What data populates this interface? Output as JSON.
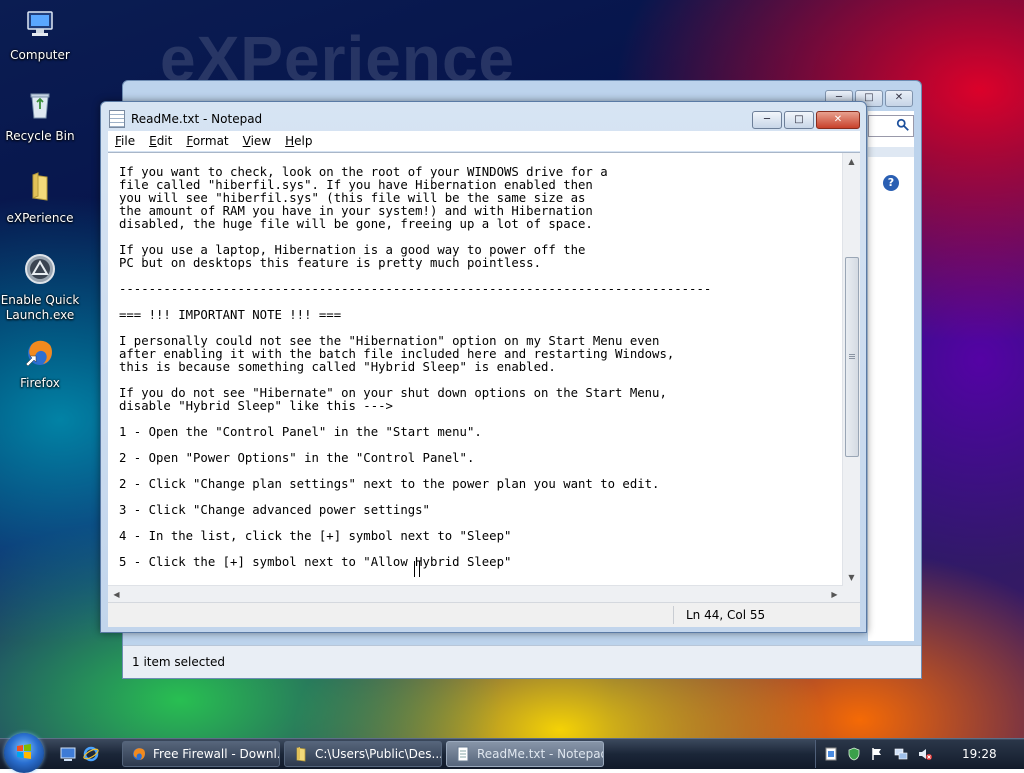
{
  "desktop": {
    "watermark": "eXPerience",
    "icons": [
      {
        "label": "Computer",
        "icon": "computer-icon"
      },
      {
        "label": "Recycle Bin",
        "icon": "recycle-bin-icon"
      },
      {
        "label": "eXPerience",
        "icon": "folder-icon"
      },
      {
        "label": "Enable Quick\nLaunch.exe",
        "icon": "app-icon"
      },
      {
        "label": "Firefox",
        "icon": "firefox-icon"
      }
    ]
  },
  "explorer": {
    "status_text": "1 item selected",
    "help_glyph": "?"
  },
  "notepad": {
    "title": "ReadMe.txt - Notepad",
    "menu": [
      "File",
      "Edit",
      "Format",
      "View",
      "Help"
    ],
    "lines": [
      "If you want to check, look on the root of your WINDOWS drive for a",
      "file called \"hiberfil.sys\". If you have Hibernation enabled then",
      "you will see \"hiberfil.sys\" (this file will be the same size as",
      "the amount of RAM you have in your system!) and with Hibernation",
      "disabled, the huge file will be gone, freeing up a lot of space.",
      "",
      "If you use a laptop, Hibernation is a good way to power off the",
      "PC but on desktops this feature is pretty much pointless.",
      "",
      "--------------------------------------------------------------------------------",
      "",
      "=== !!! IMPORTANT NOTE !!! ===",
      "",
      "I personally could not see the \"Hibernation\" option on my Start Menu even",
      "after enabling it with the batch file included here and restarting Windows,",
      "this is because something called \"Hybrid Sleep\" is enabled.",
      "",
      "If you do not see \"Hibernate\" on your shut down options on the Start Menu,",
      "disable \"Hybrid Sleep\" like this --->",
      "",
      "1 - Open the \"Control Panel\" in the \"Start menu\".",
      "",
      "2 - Open \"Power Options\" in the \"Control Panel\".",
      "",
      "2 - Click \"Change plan settings\" next to the power plan you want to edit.",
      "",
      "3 - Click \"Change advanced power settings\"",
      "",
      "4 - In the list, click the [+] symbol next to \"Sleep\"",
      "",
      "5 - Click the [+] symbol next to \"Allow Hybrid Sleep\""
    ],
    "status_position": "Ln 44, Col 55"
  },
  "taskbar": {
    "items": [
      {
        "label": "Free Firewall - Downl...",
        "icon": "firefox-icon",
        "active": false
      },
      {
        "label": "C:\\Users\\Public\\Des...",
        "icon": "folder-icon",
        "active": false
      },
      {
        "label": "ReadMe.txt - Notepad",
        "icon": "notepad-icon",
        "active": true
      }
    ],
    "clock": "19:28"
  },
  "colors": {
    "accent": "#2a6fd0",
    "close_button": "#c8412b",
    "taskbar": "#1b2638"
  }
}
